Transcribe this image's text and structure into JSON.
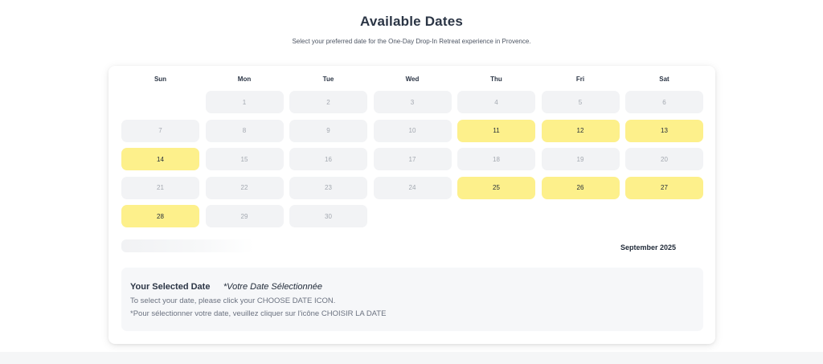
{
  "header": {
    "title": "Available Dates",
    "subtitle": "Select your preferred date for the One-Day Drop-In Retreat experience in Provence."
  },
  "calendar": {
    "weekdays": [
      "Sun",
      "Mon",
      "Tue",
      "Wed",
      "Thu",
      "Fri",
      "Sat"
    ],
    "month_label": "September 2025",
    "leading_blanks": 1,
    "days": [
      {
        "day": "1",
        "available": false
      },
      {
        "day": "2",
        "available": false
      },
      {
        "day": "3",
        "available": false
      },
      {
        "day": "4",
        "available": false
      },
      {
        "day": "5",
        "available": false
      },
      {
        "day": "6",
        "available": false
      },
      {
        "day": "7",
        "available": false
      },
      {
        "day": "8",
        "available": false
      },
      {
        "day": "9",
        "available": false
      },
      {
        "day": "10",
        "available": false
      },
      {
        "day": "11",
        "available": true
      },
      {
        "day": "12",
        "available": true
      },
      {
        "day": "13",
        "available": true
      },
      {
        "day": "14",
        "available": true
      },
      {
        "day": "15",
        "available": false
      },
      {
        "day": "16",
        "available": false
      },
      {
        "day": "17",
        "available": false
      },
      {
        "day": "18",
        "available": false
      },
      {
        "day": "19",
        "available": false
      },
      {
        "day": "20",
        "available": false
      },
      {
        "day": "21",
        "available": false
      },
      {
        "day": "22",
        "available": false
      },
      {
        "day": "23",
        "available": false
      },
      {
        "day": "24",
        "available": false
      },
      {
        "day": "25",
        "available": true
      },
      {
        "day": "26",
        "available": true
      },
      {
        "day": "27",
        "available": true
      },
      {
        "day": "28",
        "available": true
      },
      {
        "day": "29",
        "available": false
      },
      {
        "day": "30",
        "available": false
      }
    ],
    "colors": {
      "available": "#fdf08b",
      "unavailable": "#f2f3f5"
    }
  },
  "selection": {
    "title": "Your Selected Date",
    "title_fr": "*Votre Date Sélectionnée",
    "instruction": "To select your date, please click your CHOOSE DATE ICON.",
    "instruction_fr": "*Pour sélectionner votre date, veuillez cliquer sur l'icône CHOISIR LA DATE"
  }
}
